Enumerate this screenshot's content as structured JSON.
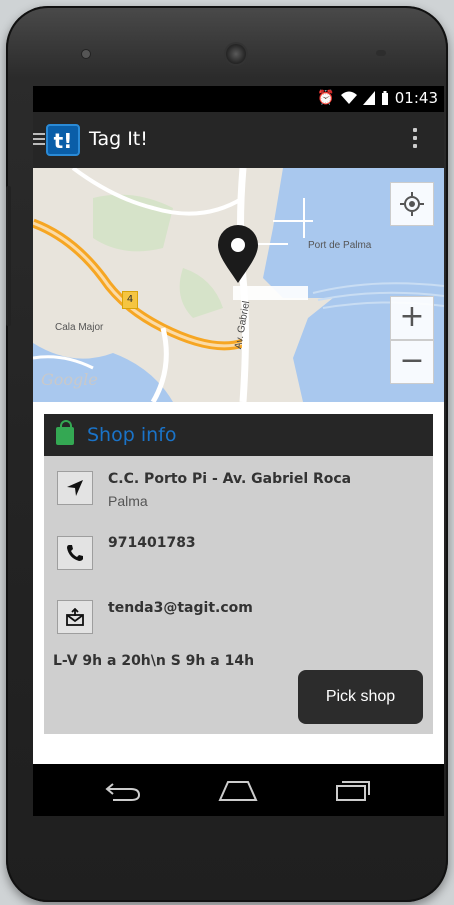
{
  "status_bar": {
    "time": "01:43",
    "icons": [
      "alarm-icon",
      "wifi-icon",
      "signal-icon",
      "battery-icon"
    ]
  },
  "action_bar": {
    "logo_text": "t!",
    "title": "Tag It!",
    "menu_icon": "hamburger-icon",
    "overflow_icon": "overflow-menu-icon"
  },
  "map": {
    "labels": {
      "port": "Port de Palma",
      "area": "Cala Major",
      "street": "Av. Gabriel",
      "road_number": "4",
      "attribution": "Google"
    },
    "controls": {
      "zoom_in": "+",
      "zoom_out": "−",
      "locate_icon": "my-location-icon"
    }
  },
  "shop_info": {
    "title": "Shop info",
    "address_line": "C.C. Porto Pi - Av. Gabriel Roca",
    "city": "Palma",
    "phone": "971401783",
    "email": "tenda3@tagit.com",
    "hours": "L-V 9h a 20h\\n S 9h a 14h",
    "pick_button": "Pick shop"
  },
  "colors": {
    "accent_blue": "#1a73c8",
    "bag_green": "#34a853",
    "dark_bar": "#262626",
    "card_bg": "#cfcfcf"
  }
}
